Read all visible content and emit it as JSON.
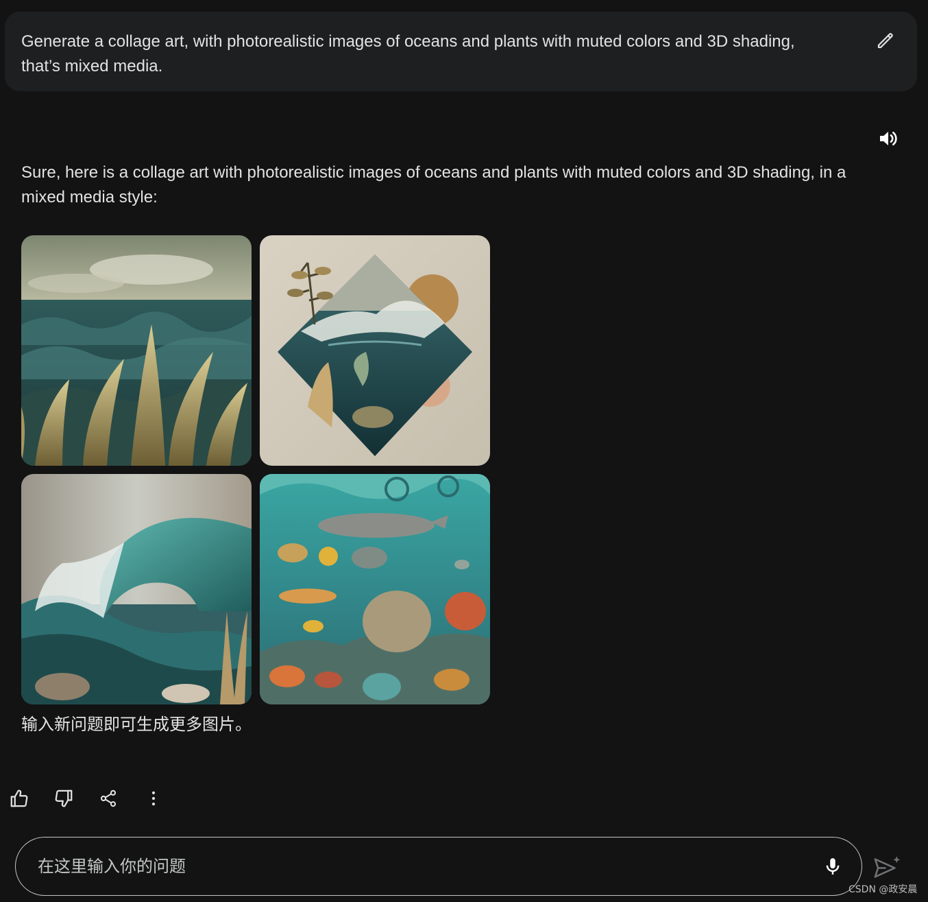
{
  "prompt": {
    "text": "Generate a collage art, with photorealistic images of oceans and plants with muted colors and 3D shading, that’s mixed media.",
    "edit_icon": "pencil-icon"
  },
  "response": {
    "speaker_icon": "volume-icon",
    "text": "Sure, here is a collage art with photorealistic images of oceans and plants with muted colors and 3D shading, in a mixed media style:",
    "footer_note": "输入新问题即可生成更多图片。"
  },
  "actions": {
    "icons": [
      "thumb-up-icon",
      "thumb-down-icon",
      "share-icon",
      "more-vert-icon"
    ]
  },
  "input": {
    "placeholder": "在这里输入你的问题",
    "mic_icon": "mic-icon",
    "send_icon": "send-icon"
  },
  "watermark": "CSDN @政安晨",
  "colors": {
    "background": "#131314",
    "bubble": "#1e1f20",
    "text": "#e3e3e3",
    "outline": "#c4c7c5"
  }
}
